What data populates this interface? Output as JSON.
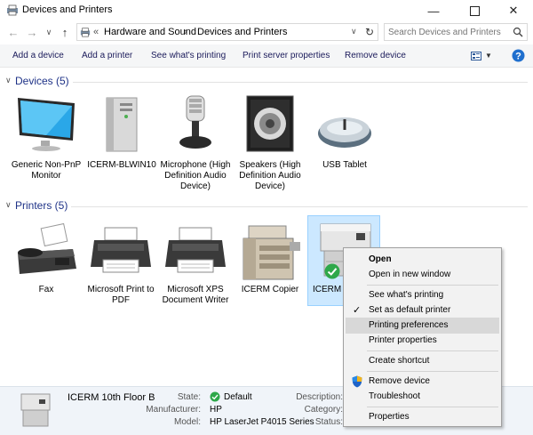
{
  "window": {
    "title": "Devices and Printers"
  },
  "nav": {
    "breadcrumb_prefix": "«",
    "crumbs": [
      "Hardware and Sound",
      "Devices and Printers"
    ],
    "search_placeholder": "Search Devices and Printers"
  },
  "toolbar": {
    "add_device": "Add a device",
    "add_printer": "Add a printer",
    "see_printing": "See what's printing",
    "print_server": "Print server properties",
    "remove_device": "Remove device"
  },
  "groups": {
    "devices": {
      "title": "Devices (5)",
      "items": [
        {
          "label": "Generic Non-PnP Monitor",
          "icon": "monitor-icon"
        },
        {
          "label": "ICERM-BLWIN10",
          "icon": "computer-tower-icon"
        },
        {
          "label": "Microphone (High Definition Audio Device)",
          "icon": "microphone-icon"
        },
        {
          "label": "Speakers (High Definition Audio Device)",
          "icon": "speaker-icon"
        },
        {
          "label": "USB Tablet",
          "icon": "mouse-icon"
        }
      ]
    },
    "printers": {
      "title": "Printers (5)",
      "items": [
        {
          "label": "Fax",
          "icon": "fax-icon"
        },
        {
          "label": "Microsoft Print to PDF",
          "icon": "printer-icon"
        },
        {
          "label": "Microsoft XPS Document Writer",
          "icon": "printer-icon"
        },
        {
          "label": "ICERM Copier",
          "icon": "copier-icon"
        },
        {
          "label": "ICERM 1",
          "icon": "laser-printer-icon"
        }
      ]
    }
  },
  "context_menu": {
    "open": "Open",
    "open_new_window": "Open in new window",
    "see_printing": "See what's printing",
    "set_default": "Set as default printer",
    "printing_preferences": "Printing preferences",
    "printer_properties": "Printer properties",
    "create_shortcut": "Create shortcut",
    "remove_device": "Remove device",
    "troubleshoot": "Troubleshoot",
    "properties": "Properties"
  },
  "details": {
    "name": "ICERM 10th Floor B",
    "state_label": "State:",
    "state_value": "Default",
    "manufacturer_label": "Manufacturer:",
    "manufacturer_value": "HP",
    "model_label": "Model:",
    "model_value": "HP LaserJet P4015 Series",
    "description_label": "Description:",
    "category_label": "Category:",
    "status_label": "Status:"
  },
  "colors": {
    "accent": "#1e3287",
    "selection": "#cce8ff",
    "callout_arrow": "#2b8fe0",
    "default_check": "#2ea84a"
  }
}
